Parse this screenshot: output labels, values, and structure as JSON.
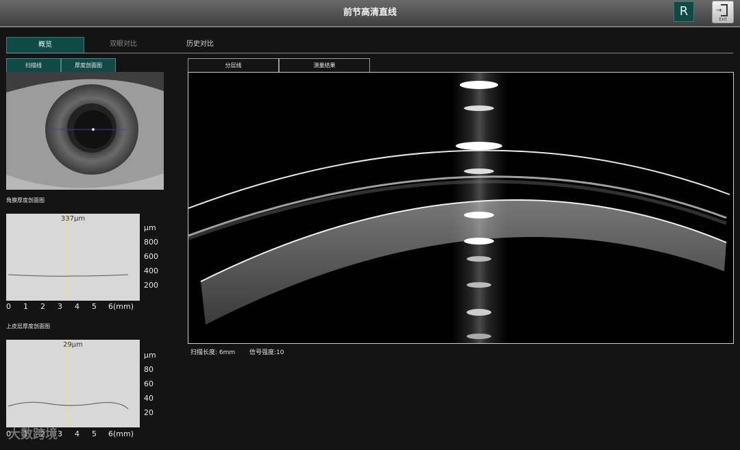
{
  "window": {
    "title": "前节高清直线",
    "r_label": "R",
    "exit_label": "Exit"
  },
  "tabs": [
    {
      "label": "概览",
      "state": "active"
    },
    {
      "label": "双眼对比",
      "state": "dim"
    },
    {
      "label": "历史对比",
      "state": "normal"
    }
  ],
  "left_subtabs": [
    {
      "label": "扫描线"
    },
    {
      "label": "厚度剖面图"
    }
  ],
  "right_subtabs": [
    {
      "label": "分层线"
    },
    {
      "label": "测量结果"
    }
  ],
  "cornea_chart": {
    "title": "角膜厚度剖面图",
    "current_value": "337μm",
    "unit": "μm",
    "y_ticks": [
      "800",
      "600",
      "400",
      "200"
    ],
    "x_ticks": [
      "0",
      "1",
      "2",
      "3",
      "4",
      "5",
      "6(mm)"
    ]
  },
  "epi_chart": {
    "title": "上皮层厚度剖面图",
    "current_value": "29μm",
    "unit": "μm",
    "y_ticks": [
      "80",
      "60",
      "40",
      "20"
    ],
    "x_ticks": [
      "0",
      "1",
      "2",
      "3",
      "4",
      "5",
      "6(mm)"
    ]
  },
  "scan_info": {
    "scan_length": "扫描长度:  6mm",
    "signal_strength": "信号强度:10"
  },
  "watermark": "大数跨境",
  "colors": {
    "accent": "#0f4a44",
    "cursor": "#e5e08a",
    "plot_bg": "#d8d8d8"
  }
}
